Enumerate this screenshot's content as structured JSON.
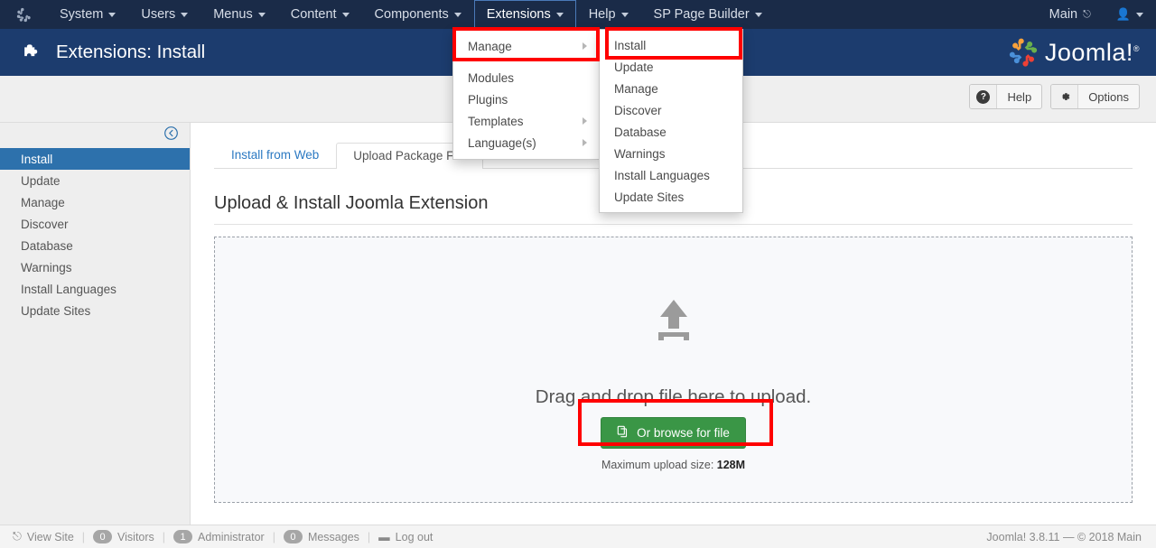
{
  "topbar": {
    "brand_icon": "joomla-mark-icon",
    "items": [
      {
        "label": "System",
        "has_caret": true
      },
      {
        "label": "Users",
        "has_caret": true
      },
      {
        "label": "Menus",
        "has_caret": true
      },
      {
        "label": "Content",
        "has_caret": true
      },
      {
        "label": "Components",
        "has_caret": true
      },
      {
        "label": "Extensions",
        "has_caret": true,
        "active": true
      },
      {
        "label": "Help",
        "has_caret": true
      },
      {
        "label": "SP Page Builder",
        "has_caret": true
      }
    ],
    "site_link": "Main",
    "site_link_icon": "external-link-icon",
    "user_icon": "user-icon"
  },
  "subhead": {
    "icon": "puzzle-piece-icon",
    "title": "Extensions: Install",
    "logo_text": "Joomla!",
    "logo_reg": "®"
  },
  "toolbar": {
    "help_label": "Help",
    "help_icon": "question-circle-icon",
    "options_label": "Options",
    "options_icon": "gear-icon"
  },
  "sidebar": {
    "toggle_icon": "collapse-left-arrow-icon",
    "items": [
      {
        "label": "Install",
        "active": true
      },
      {
        "label": "Update",
        "active": false
      },
      {
        "label": "Manage",
        "active": false
      },
      {
        "label": "Discover",
        "active": false
      },
      {
        "label": "Database",
        "active": false
      },
      {
        "label": "Warnings",
        "active": false
      },
      {
        "label": "Install Languages",
        "active": false
      },
      {
        "label": "Update Sites",
        "active": false
      }
    ]
  },
  "main": {
    "tabs": [
      {
        "label": "Install from Web",
        "active": false
      },
      {
        "label": "Upload Package File",
        "active": true
      }
    ],
    "panel_title": "Upload & Install Joomla Extension",
    "dropzone": {
      "icon": "upload-arrow-icon",
      "text": "Drag and drop file here to upload.",
      "button_label": "Or browse for file",
      "button_icon": "copy-files-icon",
      "max_label": "Maximum upload size:",
      "max_value": "128M"
    }
  },
  "menus": {
    "extensions": [
      {
        "label": "Manage",
        "submenu": true,
        "highlighted": true
      },
      {
        "label": "Modules",
        "submenu": false,
        "highlighted": false
      },
      {
        "label": "Plugins",
        "submenu": false,
        "highlighted": false
      },
      {
        "label": "Templates",
        "submenu": true,
        "highlighted": false
      },
      {
        "label": "Language(s)",
        "submenu": true,
        "highlighted": false
      }
    ],
    "manage": [
      {
        "label": "Install",
        "highlighted": true
      },
      {
        "label": "Update",
        "highlighted": false
      },
      {
        "label": "Manage",
        "highlighted": false
      },
      {
        "label": "Discover",
        "highlighted": false
      },
      {
        "label": "Database",
        "highlighted": false
      },
      {
        "label": "Warnings",
        "highlighted": false
      },
      {
        "label": "Install Languages",
        "highlighted": false
      },
      {
        "label": "Update Sites",
        "highlighted": false
      }
    ]
  },
  "footer": {
    "view_site": "View Site",
    "view_site_icon": "external-link-icon",
    "visitors_count": "0",
    "visitors_label": "Visitors",
    "admin_count": "1",
    "admin_label": "Administrator",
    "messages_count": "0",
    "messages_label": "Messages",
    "logout_label": "Log out",
    "logout_icon": "minus-icon",
    "version": "Joomla! 3.8.11  —  © 2018 Main"
  },
  "colors": {
    "topbar_navy": "#1a2b48",
    "subhead_navy": "#1c3c6e",
    "sidebar_active_blue": "#2d71ac",
    "link_blue": "#2b79c2",
    "green_button": "#3a9646",
    "highlight_red": "#ff0000",
    "joomla_orange": "#f9a13a"
  }
}
